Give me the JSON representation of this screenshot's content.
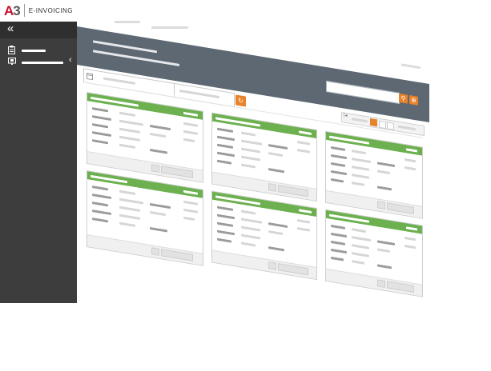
{
  "brand": {
    "mark_prefix": "A",
    "mark_suffix": "3",
    "product": "E-INVOICING"
  },
  "colors": {
    "accent_green": "#6cb04f",
    "header_slate": "#5d6872",
    "sidebar_dark": "#3d3d3d",
    "action_orange": "#e8822b",
    "brand_red": "#c8102e"
  },
  "icons": {
    "collapse": "double-chevron-left-icon",
    "menu_item_1": "clipboard-icon",
    "menu_item_2": "monitor-icon",
    "calendar": "calendar-icon",
    "refresh": "refresh-icon",
    "search": "search-icon",
    "zoom": "zoom-icon",
    "grid_view": "grid-view-icon"
  },
  "sidebar": {
    "collapse_glyph": "«",
    "submenu_glyph": "‹"
  },
  "toolbar": {
    "refresh_glyph": "↻",
    "search_glyph": "⚲",
    "zoom_glyph": "⊕",
    "first_page_glyph": "|◂",
    "view_glyph": "▪"
  },
  "cards_count_visible": 6
}
